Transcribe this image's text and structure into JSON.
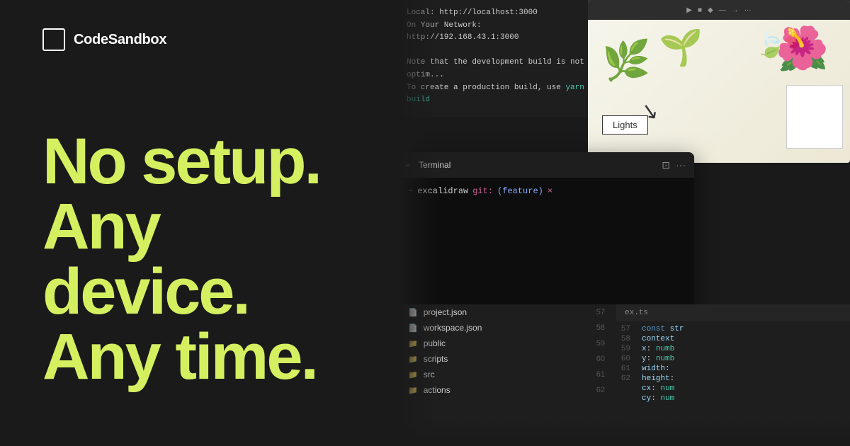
{
  "logo": {
    "text": "CodeSandbox"
  },
  "headline": {
    "line1": "No setup.",
    "line2": "Any device.",
    "line3": "Any time."
  },
  "dev_server": {
    "line1": "Local:      http://localhost:3000",
    "line2": "On Your Network: http://192.168.43.1:3000",
    "line3": "Note that the development build is not optim...",
    "line4": "To create a production build, use yarn build"
  },
  "terminal": {
    "title": "Terminal",
    "prompt": "excalidraw",
    "git_label": "git:",
    "branch": "(feature)",
    "dirty": "×"
  },
  "file_explorer": {
    "items": [
      {
        "type": "file",
        "name": "project.json",
        "line": "57"
      },
      {
        "type": "file",
        "name": "workspace.json",
        "line": "58"
      },
      {
        "type": "folder",
        "name": "public",
        "line": "59"
      },
      {
        "type": "folder",
        "name": "scripts",
        "line": "60"
      },
      {
        "type": "folder",
        "name": "src",
        "line": "61"
      },
      {
        "type": "folder",
        "name": "actions",
        "line": "62"
      }
    ]
  },
  "code_editor": {
    "filename": "ex.ts",
    "lines": [
      {
        "num": "57",
        "code": "const str"
      },
      {
        "num": "58",
        "code": "context"
      },
      {
        "num": "59",
        "code": "x: numb"
      },
      {
        "num": "60",
        "code": "y: numb"
      },
      {
        "num": "61",
        "code": "width:"
      },
      {
        "num": "62",
        "code": "height:"
      },
      {
        "num": "",
        "code": "cx: num"
      },
      {
        "num": "",
        "code": "cy: num"
      }
    ]
  },
  "design": {
    "lights_label": "Lights"
  }
}
